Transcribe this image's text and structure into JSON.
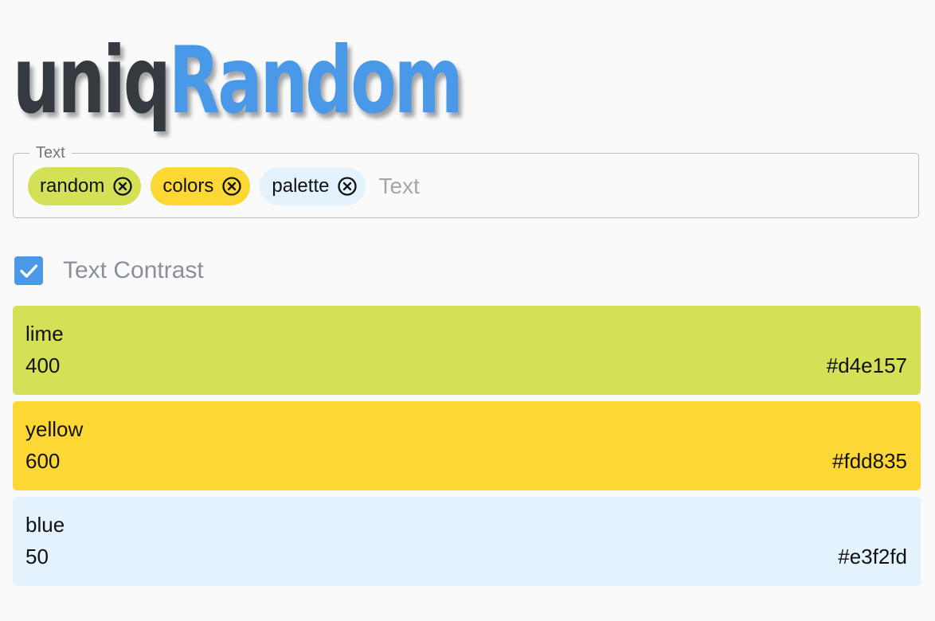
{
  "app": {
    "logo_part1": "uniq",
    "logo_part2": "Random",
    "logo_accent_color": "#4a98e8"
  },
  "text_field": {
    "legend": "Text",
    "placeholder": "Text",
    "value": "",
    "chips": [
      {
        "label": "random",
        "color": "#d4e157"
      },
      {
        "label": "colors",
        "color": "#fdd835"
      },
      {
        "label": "palette",
        "color": "#e3f2fd"
      }
    ]
  },
  "contrast_checkbox": {
    "label": "Text Contrast",
    "checked": true,
    "color": "#4a98e8"
  },
  "colors": [
    {
      "name": "lime",
      "shade": "400",
      "hex": "#d4e157"
    },
    {
      "name": "yellow",
      "shade": "600",
      "hex": "#fdd835"
    },
    {
      "name": "blue",
      "shade": "50",
      "hex": "#e3f2fd"
    }
  ]
}
